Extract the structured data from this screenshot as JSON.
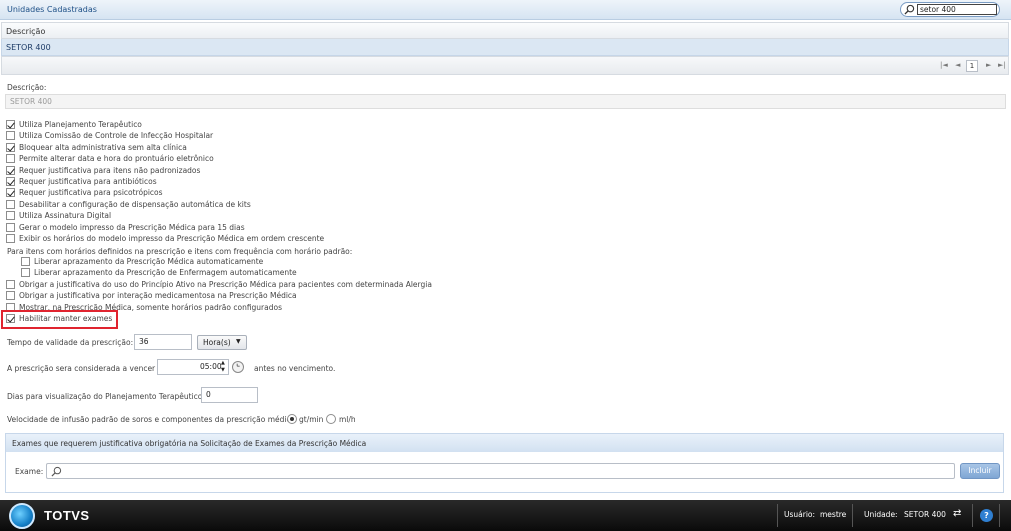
{
  "header": {
    "title": "Unidades Cadastradas",
    "search_value": "setor 400"
  },
  "grid": {
    "column_header": "Descrição",
    "rows": [
      "SETOR 400"
    ],
    "pager": {
      "first": "|◄",
      "prev": "◄",
      "page": "1",
      "next": "►",
      "last": "►|"
    }
  },
  "form": {
    "descricao_label": "Descrição:",
    "descricao_value": "SETOR 400",
    "options": [
      {
        "label": "Utiliza Planejamento Terapêutico",
        "checked": true
      },
      {
        "label": "Utiliza Comissão de Controle de Infecção Hospitalar",
        "checked": false
      },
      {
        "label": "Bloquear alta administrativa sem alta clínica",
        "checked": true
      },
      {
        "label": "Permite alterar data e hora do prontuário eletrônico",
        "checked": false
      },
      {
        "label": "Requer justificativa para itens não padronizados",
        "checked": true
      },
      {
        "label": "Requer justificativa para antibióticos",
        "checked": true
      },
      {
        "label": "Requer justificativa para psicotrópicos",
        "checked": true
      },
      {
        "label": "Desabilitar a configuração de dispensação automática de kits",
        "checked": false
      },
      {
        "label": "Utiliza Assinatura Digital",
        "checked": false
      },
      {
        "label": "Gerar o modelo impresso da Prescrição Médica para 15 dias",
        "checked": false
      },
      {
        "label": "Exibir os horários do modelo impresso da Prescrição Médica em ordem crescente",
        "checked": false
      }
    ],
    "frequency_heading": "Para itens com horários definidos na prescrição e itens com frequência com horário padrão:",
    "sub_options": [
      {
        "label": "Liberar aprazamento da Prescrição Médica automaticamente",
        "checked": false
      },
      {
        "label": "Liberar aprazamento da Prescrição de Enfermagem automaticamente",
        "checked": false
      }
    ],
    "options2": [
      {
        "label": "Obrigar a justificativa do uso do Princípio Ativo na Prescrição Médica para pacientes com determinada Alergia",
        "checked": false
      },
      {
        "label": "Obrigar a justificativa por interação medicamentosa na Prescrição Médica",
        "checked": false
      },
      {
        "label": "Mostrar, na Prescrição Médica, somente horários padrão configurados",
        "checked": false
      },
      {
        "label": "Habilitar manter exames",
        "checked": true
      }
    ],
    "validade_label": "Tempo de validade da prescrição:",
    "validade_value": "36",
    "validade_unit": "Hora(s)",
    "vencer_label": "A prescrição sera considerada a vencer",
    "vencer_value": "05:00",
    "vencer_suffix": "antes no vencimento.",
    "dias_label": "Dias para visualização do Planejamento Terapêutico",
    "dias_value": "0",
    "velocidade_label": "Velocidade de infusão padrão de soros e componentes da prescrição médica",
    "velocidade_opt1": "gt/min",
    "velocidade_opt2": "ml/h",
    "velocidade_selected": "gt/min"
  },
  "exams_panel": {
    "title": "Exames que requerem justificativa obrigatória na Solicitação de Exames da Prescrição Médica",
    "exame_label": "Exame:",
    "include_label": "Incluir"
  },
  "footer": {
    "logo": "TOTVS",
    "usuario_label": "Usuário:",
    "usuario_value": "mestre",
    "unidade_label": "Unidade:",
    "unidade_value": "SETOR 400",
    "help": "?"
  }
}
